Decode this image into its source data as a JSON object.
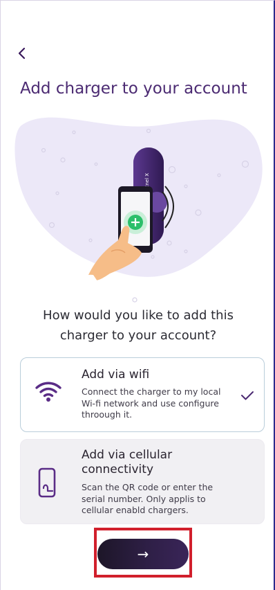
{
  "header": {
    "back_icon": "chevron-left-icon",
    "title": "Add charger to your account"
  },
  "illustration": {
    "charger_brand": "Enel X",
    "phone_badge_icon": "plus-icon"
  },
  "question": {
    "line1": "How would you like to add this",
    "line2": "charger to your account?"
  },
  "options": [
    {
      "title": "Add via wifi",
      "description": "Connect the charger to my local Wi-fi network and use configure throough it.",
      "icon": "wifi-icon",
      "selected": true,
      "status_icon": "checkmark-icon"
    },
    {
      "title_line1": "Add via cellular",
      "title_line2": "connectivity",
      "description": "Scan the QR code or enter the serial number. Only applis to cellular enabld chargers.",
      "icon": "phone-icon",
      "selected": false
    }
  ],
  "next_button": {
    "label": "→",
    "icon": "arrow-right-icon"
  },
  "colors": {
    "accent": "#4b2a72",
    "icon_purple": "#5a2c86",
    "selected_border": "#b9cdda",
    "unselected_bg": "#f1f0f3",
    "button_dark": "#1d1628",
    "blob": "#ece8f8",
    "plus_green": "#2bbf6a",
    "highlight_red": "#d11f2c"
  }
}
